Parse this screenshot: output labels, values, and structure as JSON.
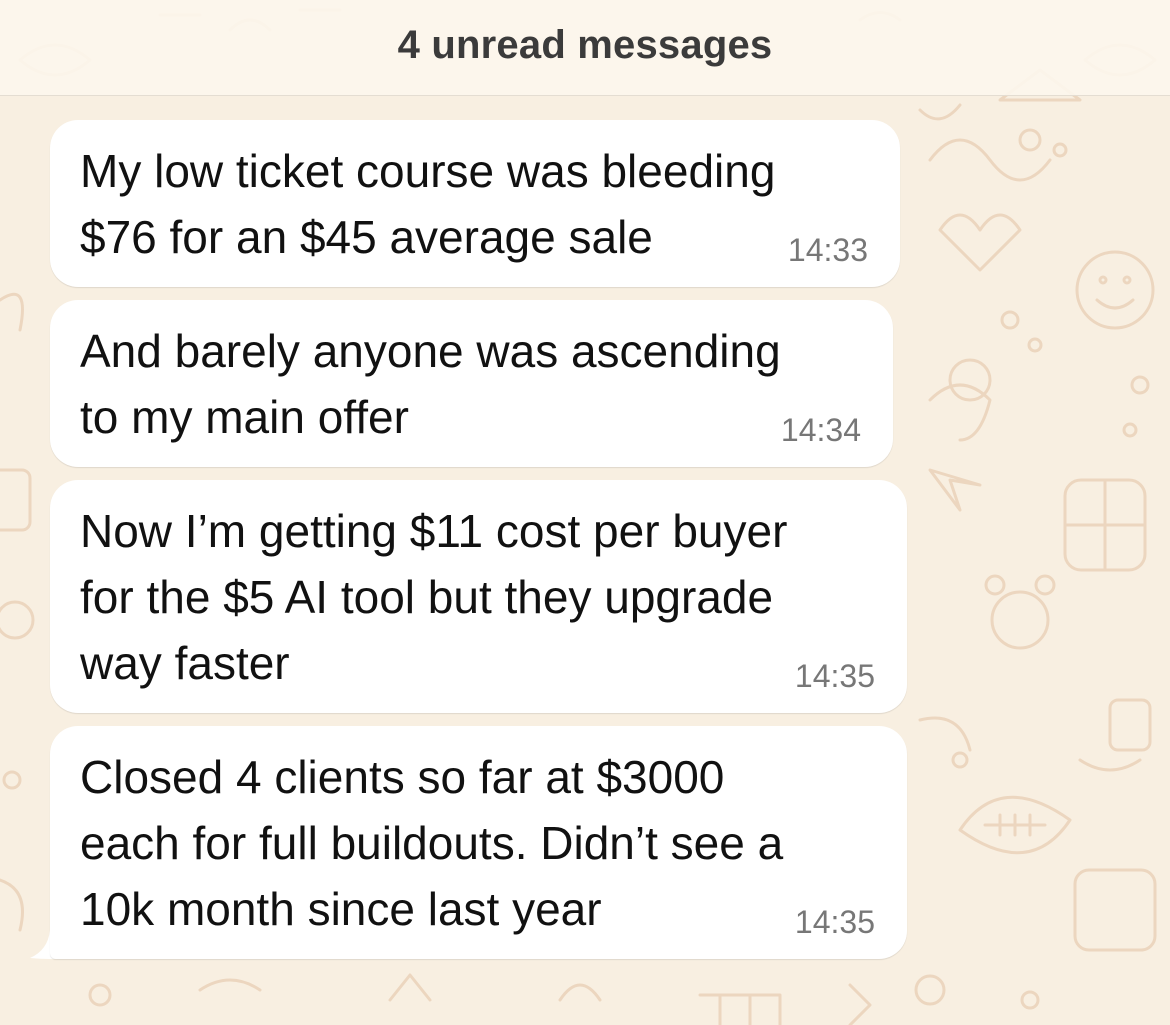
{
  "banner": {
    "unread_label": "4 unread messages"
  },
  "messages": [
    {
      "text": "My low ticket course was bleeding\n$76 for an $45 average sale",
      "time": "14:33"
    },
    {
      "text": "And barely anyone was ascending\nto my main offer",
      "time": "14:34"
    },
    {
      "text": "Now I’m getting $11 cost per buyer\nfor the $5 AI tool but they upgrade\nway faster",
      "time": "14:35"
    },
    {
      "text": "Closed 4 clients so far at $3000\neach for full buildouts. Didn’t see a\n10k month since last year",
      "time": "14:35"
    }
  ],
  "colors": {
    "background": "#f8efe1",
    "bubble": "#ffffff",
    "doodle_stroke": "#ecd6bf",
    "text": "#111111",
    "timestamp": "#777777",
    "banner_text": "#3b3b3b"
  }
}
